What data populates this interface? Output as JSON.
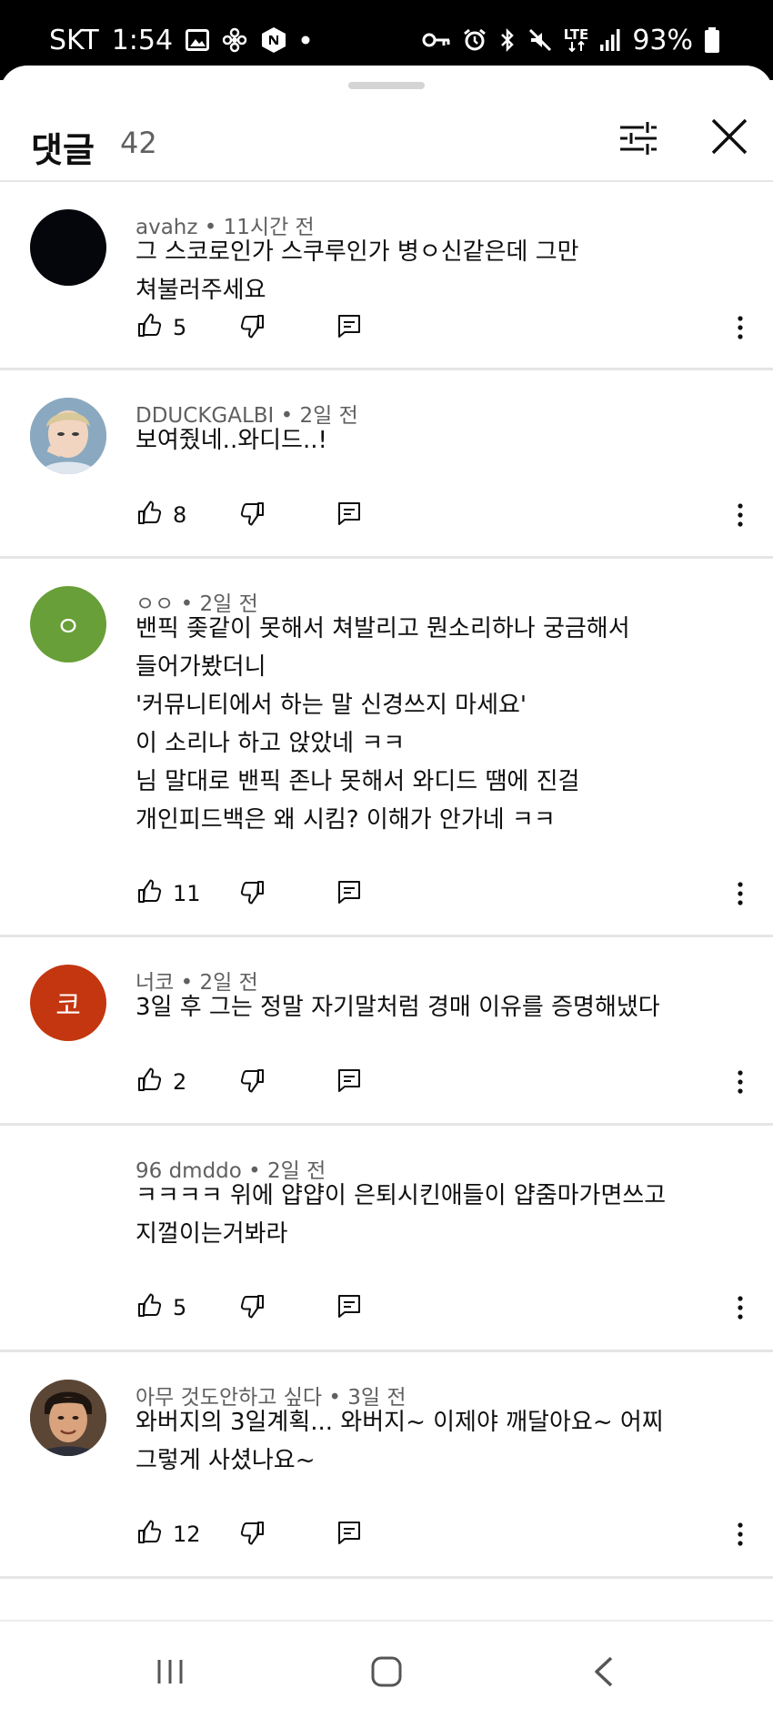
{
  "status_bar": {
    "carrier": "SKT",
    "time": "1:54",
    "network_top": "LTE",
    "battery": "93%",
    "icons": [
      "image-icon",
      "pinwheel-icon",
      "n-app-icon",
      "dot-icon",
      "key-icon",
      "alarm-icon",
      "bluetooth-icon",
      "mute-icon",
      "signal-icon",
      "battery-icon"
    ]
  },
  "header": {
    "title": "댓글",
    "count": "42",
    "icons": [
      "sort-filter-icon",
      "close-icon"
    ]
  },
  "comments": [
    {
      "author": "avahz • 11시간 전",
      "lines": [
        "그 스코로인가 스쿠루인가 병ㅇ신같은데 그만",
        "쳐불러주세요"
      ],
      "likes": "5",
      "avatar_text": "",
      "avatar_color": "#05060c"
    },
    {
      "author": "DDUCKGALBI • 2일 전",
      "lines": [
        "보여줬네..와디드..!"
      ],
      "likes": "8",
      "avatar_text": "",
      "avatar_color": "#6f8fa8"
    },
    {
      "author": "ㅇㅇ • 2일 전",
      "lines": [
        "밴픽 좆같이 못해서 쳐발리고 뭔소리하나 궁금해서",
        "들어가봤더니",
        "'커뮤니티에서 하는 말 신경쓰지 마세요'",
        "이 소리나 하고 앉았네 ㅋㅋ",
        "님 말대로 밴픽 존나 못해서 와디드 땜에 진걸",
        "개인피드백은 왜 시킴? 이해가 안가네 ㅋㅋ"
      ],
      "likes": "11",
      "avatar_text": "ㅇ",
      "avatar_color": "#689f38"
    },
    {
      "author": "너코 • 2일 전",
      "lines": [
        "3일 후 그는 정말 자기말처럼 경매 이유를 증명해냈다"
      ],
      "likes": "2",
      "avatar_text": "코",
      "avatar_color": "#c3360f"
    },
    {
      "author": "96 dmddo • 2일 전",
      "lines": [
        "ㅋㅋㅋㅋ 위에 얍얍이 은퇴시킨애들이 얍줌마가면쓰고",
        "지껄이는거봐라"
      ],
      "likes": "5",
      "avatar_text": "",
      "avatar_color": "#ffffff"
    },
    {
      "author": "아무 것도안하고 싶다 • 3일 전",
      "lines": [
        "와버지의 3일계획... 와버지~ 이제야 깨달아요~ 어찌",
        "그렇게 사셨나요~"
      ],
      "likes": "12",
      "avatar_text": "",
      "avatar_color": "#4a3a2e"
    }
  ],
  "comment_action_icons": [
    "thumb-up-icon",
    "thumb-down-icon",
    "reply-icon",
    "more-vert-icon"
  ],
  "nav_bar": {
    "icons": [
      "recent-apps-icon",
      "home-icon",
      "back-icon"
    ]
  }
}
